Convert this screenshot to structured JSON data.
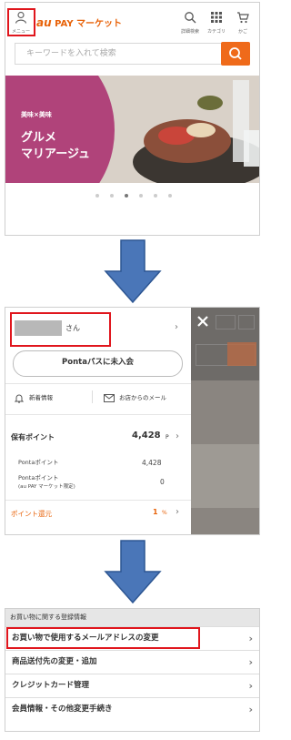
{
  "screen1": {
    "menu_label": "メニュー",
    "logo_prefix": "au",
    "logo_rest": " PAY マーケット",
    "header_icons": [
      {
        "name": "search-icon",
        "label": "詳細検索"
      },
      {
        "name": "grid-icon",
        "label": "カテゴリ"
      },
      {
        "name": "cart-icon",
        "label": "かご"
      }
    ],
    "search_placeholder": "キーワードを入れて検索",
    "banner": {
      "small": "美味×美味",
      "title": "グルメ\nマリアージュ"
    },
    "carousel_dots": 6,
    "carousel_active": 2
  },
  "screen2": {
    "user_suffix": "さん",
    "ponta_button": "Pontaパスに未入会",
    "news": "新着情報",
    "shop_mail": "お店からのメール",
    "points_label": "保有ポイント",
    "points_value": "4,428",
    "points_unit": "P",
    "ponta_points_label": "Pontaポイント",
    "ponta_points_value": "4,428",
    "ponta_limited_label1": "Pontaポイント",
    "ponta_limited_label2": "(au PAY マーケット限定)",
    "ponta_limited_value": "0",
    "refund_label": "ポイント還元",
    "refund_value": "1",
    "refund_unit": "%"
  },
  "screen3": {
    "section_title": "お買い物に関する登録情報",
    "rows": [
      "お買い物で使用するメールアドレスの変更",
      "商品送付先の変更・追加",
      "クレジットカード管理",
      "会員情報・その他変更手続き"
    ]
  },
  "colors": {
    "accent": "#ef6a1a",
    "highlight": "#e0161d",
    "arrow": "#4a76b8"
  }
}
